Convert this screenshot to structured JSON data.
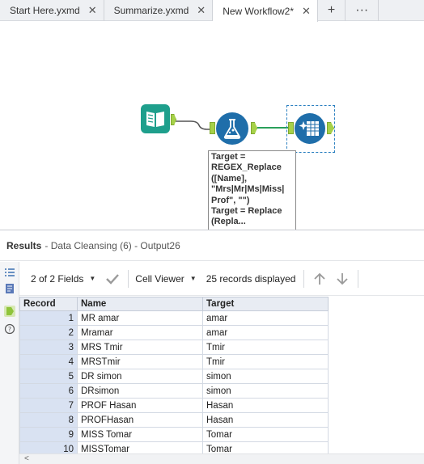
{
  "tabs": [
    {
      "label": "Start Here.yxmd",
      "active": false
    },
    {
      "label": "Summarize.yxmd",
      "active": false
    },
    {
      "label": "New Workflow2*",
      "active": true
    }
  ],
  "tab_icons": {
    "close": "close-icon",
    "add": "plus-icon",
    "more": "more-icon"
  },
  "canvas": {
    "annotation": "Target =\nREGEX_Replace\n([Name],\n\"Mrs|Mr|Ms|Miss|\nProf\", \"\")\nTarget = Replace\n(Repla..."
  },
  "results": {
    "title": "Results",
    "subtitle": "- Data Cleansing (6) - Output26",
    "fields_selector": "2 of 2 Fields",
    "viewer": "Cell Viewer",
    "records_info": "25 records displayed"
  },
  "table": {
    "columns": [
      "Record",
      "Name",
      "Target"
    ],
    "rows": [
      [
        "1",
        "MR amar",
        "amar"
      ],
      [
        "2",
        "Mramar",
        "amar"
      ],
      [
        "3",
        "MRS Tmir",
        "Tmir"
      ],
      [
        "4",
        "MRSTmir",
        "Tmir"
      ],
      [
        "5",
        "DR simon",
        "simon"
      ],
      [
        "6",
        "DRsimon",
        "simon"
      ],
      [
        "7",
        "PROF Hasan",
        "Hasan"
      ],
      [
        "8",
        "PROFHasan",
        "Hasan"
      ],
      [
        "9",
        "MISS Tomar",
        "Tomar"
      ],
      [
        "10",
        "MISSTomar",
        "Tomar"
      ]
    ]
  },
  "colors": {
    "accent_blue": "#1f6eaa",
    "anchor_green": "#a6d149",
    "teal_tool": "#1e9f8c",
    "record_cell": "#d9e2f2"
  }
}
